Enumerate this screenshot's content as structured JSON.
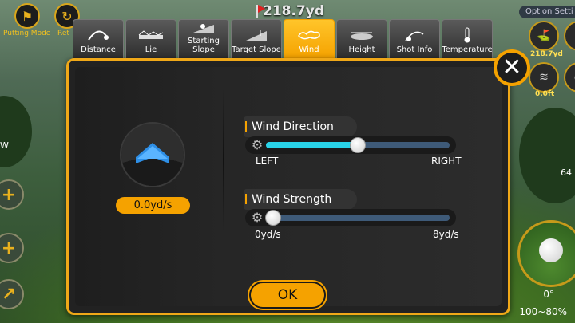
{
  "hud": {
    "putting_mode_label": "Putting Mode",
    "retry_label": "Ret",
    "distance": "218.7yd",
    "option_settings_label": "Option Setti",
    "right_values": [
      "218.7yd",
      "0.0ft"
    ],
    "left_w_label": "W",
    "side_value": "64",
    "angle_value": "0°",
    "power_range": "100~80%"
  },
  "tabs": [
    {
      "label": "Distance",
      "icon": "distance-icon"
    },
    {
      "label": "Lie",
      "icon": "lie-icon"
    },
    {
      "label": "Starting Slope",
      "icon": "starting-slope-icon"
    },
    {
      "label": "Target Slope",
      "icon": "target-slope-icon"
    },
    {
      "label": "Wind",
      "icon": "wind-icon",
      "active": true
    },
    {
      "label": "Height",
      "icon": "height-icon"
    },
    {
      "label": "Shot Info",
      "icon": "shot-info-icon"
    },
    {
      "label": "Temperature",
      "icon": "thermometer-icon"
    }
  ],
  "wind": {
    "speed_display": "0.0yd/s",
    "direction": {
      "title": "Wind Direction",
      "min_label": "LEFT",
      "max_label": "RIGHT",
      "value_fraction": 0.5
    },
    "strength": {
      "title": "Wind Strength",
      "min_label": "0yd/s",
      "max_label": "8yd/s",
      "value_fraction": 0.0
    }
  },
  "ok_label": "OK",
  "colors": {
    "accent": "#f5a200",
    "slider_fill": "#29d3e8",
    "slider_track": "#3e5a78",
    "arrow": "#2e8fe6"
  }
}
